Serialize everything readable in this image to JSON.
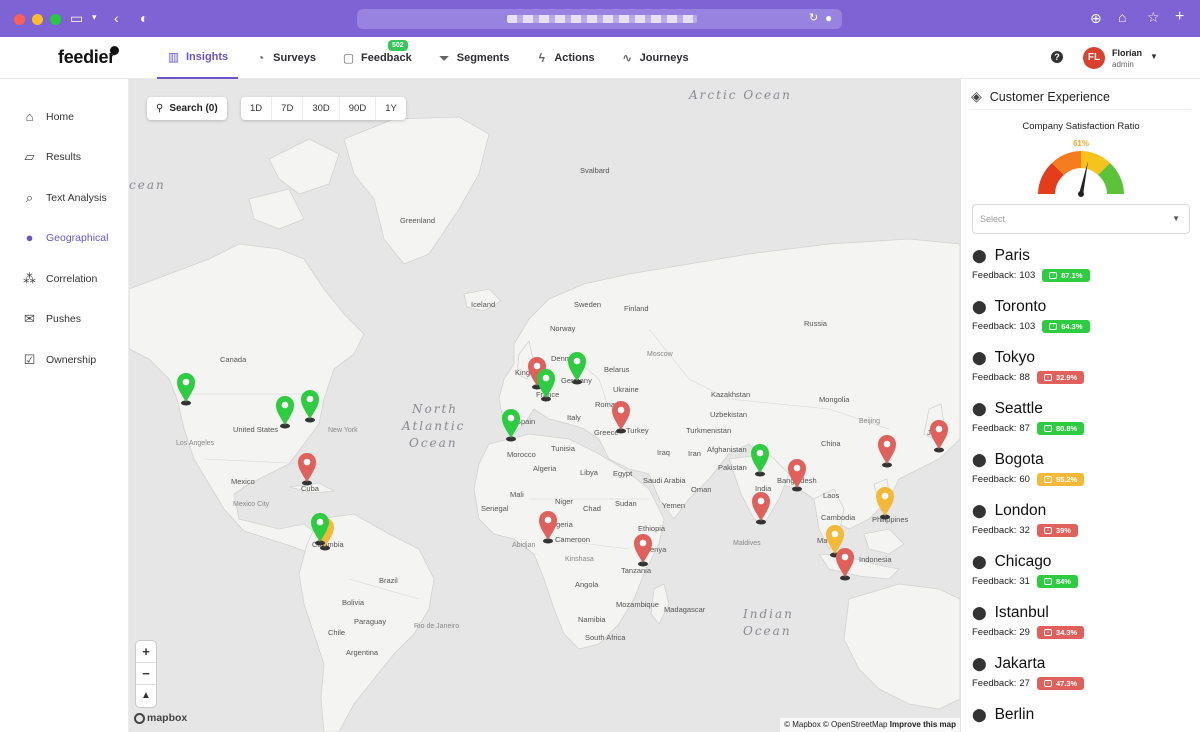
{
  "header": {
    "logo": "feedier",
    "nav": [
      {
        "label": "Insights",
        "icon": "chart-icon",
        "active": true
      },
      {
        "label": "Surveys",
        "icon": "surveys-icon"
      },
      {
        "label": "Feedback",
        "icon": "chat-icon",
        "badge": "502"
      },
      {
        "label": "Segments",
        "icon": "filter-icon"
      },
      {
        "label": "Actions",
        "icon": "bolt-icon"
      },
      {
        "label": "Journeys",
        "icon": "pulse-icon"
      }
    ],
    "user": {
      "initials": "FL",
      "name": "Florian",
      "role": "admin"
    }
  },
  "sidebar": {
    "items": [
      {
        "label": "Home",
        "icon": "home-icon"
      },
      {
        "label": "Results",
        "icon": "results-icon"
      },
      {
        "label": "Text Analysis",
        "icon": "text-analysis-icon"
      },
      {
        "label": "Geographical",
        "icon": "location-icon",
        "active": true
      },
      {
        "label": "Correlation",
        "icon": "correlation-icon"
      },
      {
        "label": "Pushes",
        "icon": "pushes-icon"
      },
      {
        "label": "Ownership",
        "icon": "ownership-icon"
      }
    ]
  },
  "map": {
    "search_label": "Search (0)",
    "ranges": [
      "1D",
      "7D",
      "30D",
      "90D",
      "1Y"
    ],
    "attribution_pre": "© Mapbox © OpenStreetMap",
    "attribution_link": "Improve this map",
    "mapbox_logo": "mapbox",
    "oceans": {
      "arctic": "Arctic Ocean",
      "north_atlantic_1": "North",
      "north_atlantic_2": "Atlantic",
      "north_atlantic_3": "Ocean",
      "indian_1": "Indian",
      "indian_2": "Ocean",
      "edge": "cean"
    },
    "labels": {
      "greenland": "Greenland",
      "svalbard": "Svalbard",
      "iceland": "Iceland",
      "sweden": "Sweden",
      "norway": "Norway",
      "russia": "Russia",
      "finland": "Finland",
      "belarus": "Belarus",
      "moscow": "Moscow",
      "ukraine": "Ukraine",
      "kazakhstan": "Kazakhstan",
      "mongolia": "Mongolia",
      "canada": "Canada",
      "united_states": "United States",
      "new_york": "New York",
      "los_angeles": "Los Angeles",
      "mexico": "Mexico",
      "mexico_city": "Mexico City",
      "cuba": "Cuba",
      "colombia": "Colombia",
      "brazil": "Brazil",
      "bolivia": "Bolivia",
      "paraguay": "Paraguay",
      "chile": "Chile",
      "argentina": "Argentina",
      "rio": "Rio de Janeiro",
      "spain": "Spain",
      "france": "France",
      "germany": "Germany",
      "denmark": "Denm",
      "kingdom": "King",
      "italy": "Italy",
      "greece": "Greece",
      "romania": "Roman",
      "turkey": "Turkey",
      "tunisia": "Tunisia",
      "morocco": "Morocco",
      "algeria": "Algeria",
      "libya": "Libya",
      "egypt": "Egypt",
      "mali": "Mali",
      "niger": "Niger",
      "chad": "Chad",
      "sudan": "Sudan",
      "senegal": "Senegal",
      "nigeria": "Nigeria",
      "abidjan": "Abidjan",
      "cameroon": "Cameroon",
      "ethiopia": "Ethiopia",
      "kenya": "Kenya",
      "tanzania": "Tanzania",
      "kinshasa": "Kinshasa",
      "angola": "Angola",
      "namibia": "Namibia",
      "mozambique": "Mozambique",
      "madagascar": "Madagascar",
      "south_africa": "South Africa",
      "saudi": "Saudi Arabia",
      "iraq": "Iraq",
      "iran": "Iran",
      "yemen": "Yemen",
      "oman": "Oman",
      "afghanistan": "Afghanistan",
      "pakistan": "Pakistan",
      "india": "India",
      "bangladesh": "Bangladesh",
      "turkmenistan": "Turkmenistan",
      "uzbekistan": "Uzbekistan",
      "china": "China",
      "beijing": "Beijing",
      "laos": "Laos",
      "cambodia": "Cambodia",
      "philippines": "Philippines",
      "malaysia": "Ma",
      "indonesia": "Indonesia",
      "maldives": "Maldives",
      "japan": "Ja"
    }
  },
  "panel": {
    "title": "Customer Experience",
    "gauge_title": "Company Satisfaction Ratio",
    "gauge_value": "61%",
    "select_placeholder": "Select",
    "feedback_prefix": "Feedback:",
    "locations": [
      {
        "name": "Paris",
        "count": "103",
        "ratio": "87.1%",
        "tone": "green"
      },
      {
        "name": "Toronto",
        "count": "103",
        "ratio": "64.3%",
        "tone": "green"
      },
      {
        "name": "Tokyo",
        "count": "88",
        "ratio": "32.9%",
        "tone": "red"
      },
      {
        "name": "Seattle",
        "count": "87",
        "ratio": "80.8%",
        "tone": "green"
      },
      {
        "name": "Bogota",
        "count": "60",
        "ratio": "55.2%",
        "tone": "orange"
      },
      {
        "name": "London",
        "count": "32",
        "ratio": "39%",
        "tone": "red"
      },
      {
        "name": "Chicago",
        "count": "31",
        "ratio": "84%",
        "tone": "green"
      },
      {
        "name": "Istanbul",
        "count": "29",
        "ratio": "34.3%",
        "tone": "red"
      },
      {
        "name": "Jakarta",
        "count": "27",
        "ratio": "47.3%",
        "tone": "red"
      },
      {
        "name": "Berlin",
        "count": "",
        "ratio": "",
        "tone": ""
      }
    ]
  },
  "colors": {
    "accent": "#6b54c9",
    "green": "#2ecc40",
    "red": "#e0605b",
    "orange": "#f5b93a"
  }
}
